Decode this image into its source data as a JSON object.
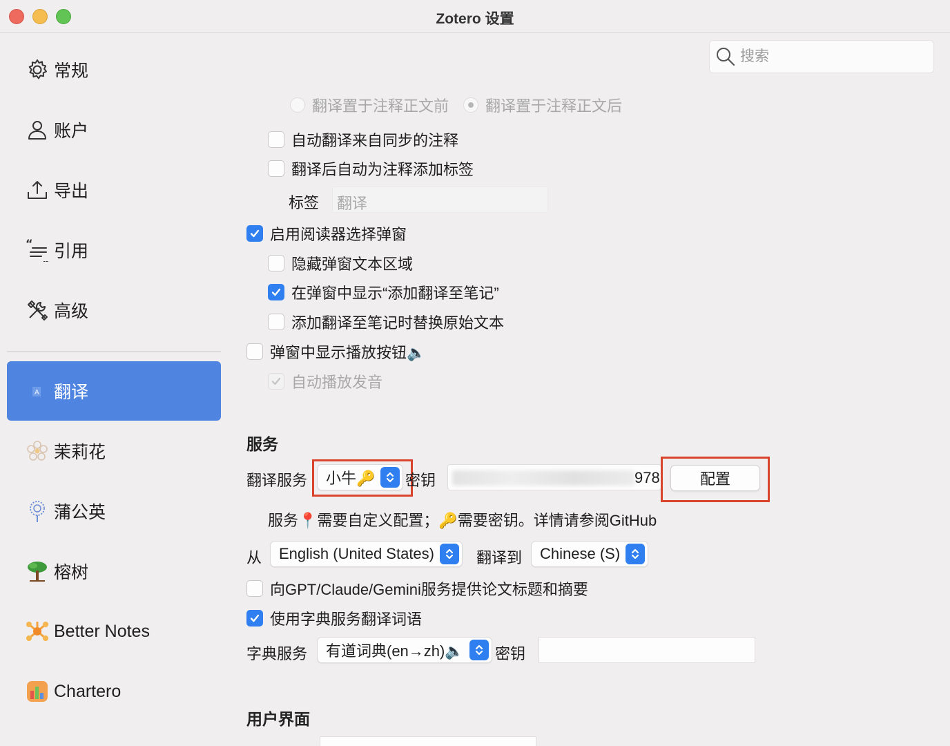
{
  "window": {
    "title": "Zotero 设置"
  },
  "sidebar": {
    "items": [
      {
        "label": "常规",
        "icon": "gear-icon"
      },
      {
        "label": "账户",
        "icon": "person-icon"
      },
      {
        "label": "导出",
        "icon": "export-icon"
      },
      {
        "label": "引用",
        "icon": "quote-icon"
      },
      {
        "label": "高级",
        "icon": "tools-icon"
      },
      {
        "label": "翻译",
        "icon": "translate-icon",
        "active": true
      },
      {
        "label": "茉莉花",
        "icon": "jasmine-icon"
      },
      {
        "label": "蒲公英",
        "icon": "dandelion-icon"
      },
      {
        "label": "榕树",
        "icon": "banyan-icon"
      },
      {
        "label": "Better Notes",
        "icon": "better-notes-icon"
      },
      {
        "label": "Chartero",
        "icon": "chartero-icon"
      }
    ]
  },
  "search": {
    "placeholder": "搜索"
  },
  "options": {
    "radio_before": "翻译置于注释正文前",
    "radio_after": "翻译置于注释正文后",
    "auto_translate_synced": "自动翻译来自同步的注释",
    "auto_add_tag": "翻译后自动为注释添加标签",
    "tag_label": "标签",
    "tag_placeholder": "翻译",
    "enable_popup": "启用阅读器选择弹窗",
    "hide_popup_text": "隐藏弹窗文本区域",
    "show_add_to_note": "在弹窗中显示“添加翻译至笔记”",
    "replace_original": "添加翻译至笔记时替换原始文本",
    "show_play_button": "弹窗中显示播放按钮🔈",
    "auto_play": "自动播放发音"
  },
  "services": {
    "heading": "服务",
    "translate_service_label": "翻译服务",
    "translate_service_value": "小牛🔑",
    "key_label": "密钥",
    "key_visible_suffix": "978",
    "config_button": "配置",
    "hint": "服务📍需要自定义配置；🔑需要密钥。详情请参阅GitHub",
    "from_label": "从",
    "from_value": "English (United States)",
    "to_label": "翻译到",
    "to_value": "Chinese (S)",
    "gpt_option": "向GPT/Claude/Gemini服务提供论文标题和摘要",
    "use_dict": "使用字典服务翻译词语",
    "dict_label": "字典服务",
    "dict_value": "有道词典(en→zh)🔈",
    "dict_key_label": "密钥"
  },
  "ui_section": {
    "heading": "用户界面"
  },
  "colors": {
    "accent": "#2f7ff0",
    "sidebar_active": "#4f85e0",
    "highlight": "#d9442c"
  }
}
